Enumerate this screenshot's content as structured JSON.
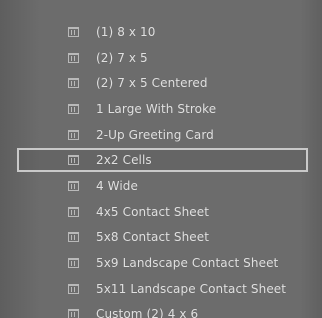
{
  "templates": {
    "items": [
      {
        "label": "(1) 8 x 10"
      },
      {
        "label": "(2) 7 x 5"
      },
      {
        "label": "(2) 7 x 5 Centered"
      },
      {
        "label": "1 Large With Stroke"
      },
      {
        "label": "2-Up Greeting Card"
      },
      {
        "label": "2x2 Cells",
        "selected": true
      },
      {
        "label": "4 Wide"
      },
      {
        "label": "4x5 Contact Sheet"
      },
      {
        "label": "5x8 Contact Sheet"
      },
      {
        "label": "5x9 Landscape Contact Sheet"
      },
      {
        "label": "5x11 Landscape Contact Sheet"
      },
      {
        "label": "Custom (2) 4 x 6"
      }
    ]
  },
  "colors": {
    "panel_bg": "#6a6a6a",
    "text": "#e0e0e0",
    "selection_border": "#c9c9c9"
  },
  "icons": {
    "template": "template-icon"
  }
}
